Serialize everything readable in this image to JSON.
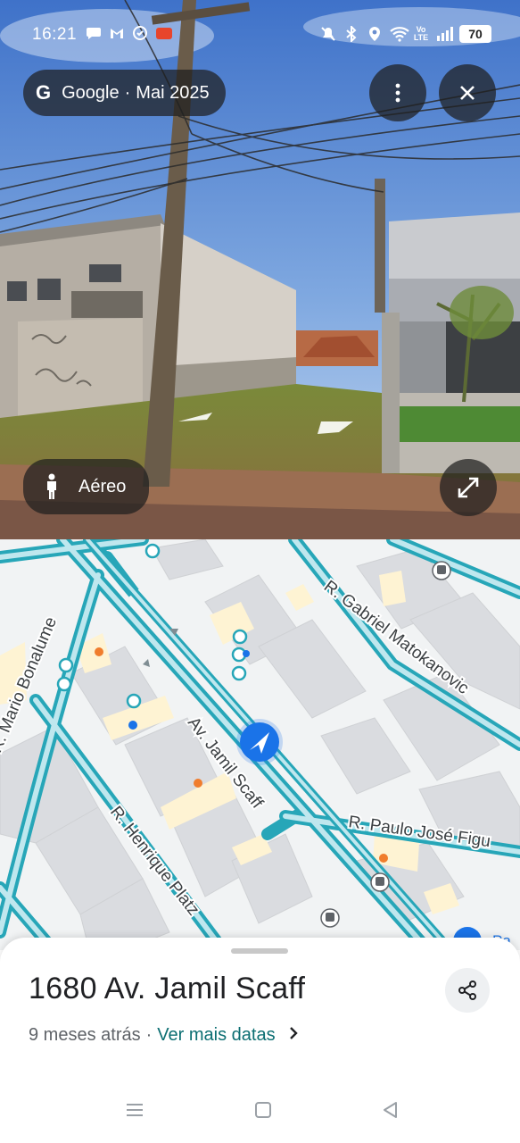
{
  "status_bar": {
    "time": "16:21",
    "left_icons": [
      "chat-icon",
      "gmail-icon",
      "shield-icon",
      "app-icon"
    ],
    "right_icons": [
      "mute-icon",
      "bluetooth-icon",
      "location-icon",
      "wifi-icon",
      "volte-icon",
      "signal-icon"
    ],
    "volte_text": "Vo\nLTE",
    "battery": "70"
  },
  "street_view": {
    "brand": "Google",
    "separator": "·",
    "capture_date": "Mai 2025",
    "mode_label": "Aéreo"
  },
  "map": {
    "streets": [
      "R. Mario Bonalume",
      "Av. Jamil Scaff",
      "R. Gabriel Matokanovic",
      "R. Henrique Platz",
      "R. Paulo José Figu"
    ],
    "edge_label": "Pa"
  },
  "sheet": {
    "address": "1680 Av.  Jamil Scaff",
    "time_ago": "9 meses atrás",
    "separator": "·",
    "more_dates_link": "Ver mais datas"
  },
  "colors": {
    "road": "#27a6b8",
    "road_inner": "#bfe7ee",
    "block": "#dadce0",
    "poi": "#fef3d3",
    "accent": "#1a73e8",
    "link": "#0b6e72"
  }
}
